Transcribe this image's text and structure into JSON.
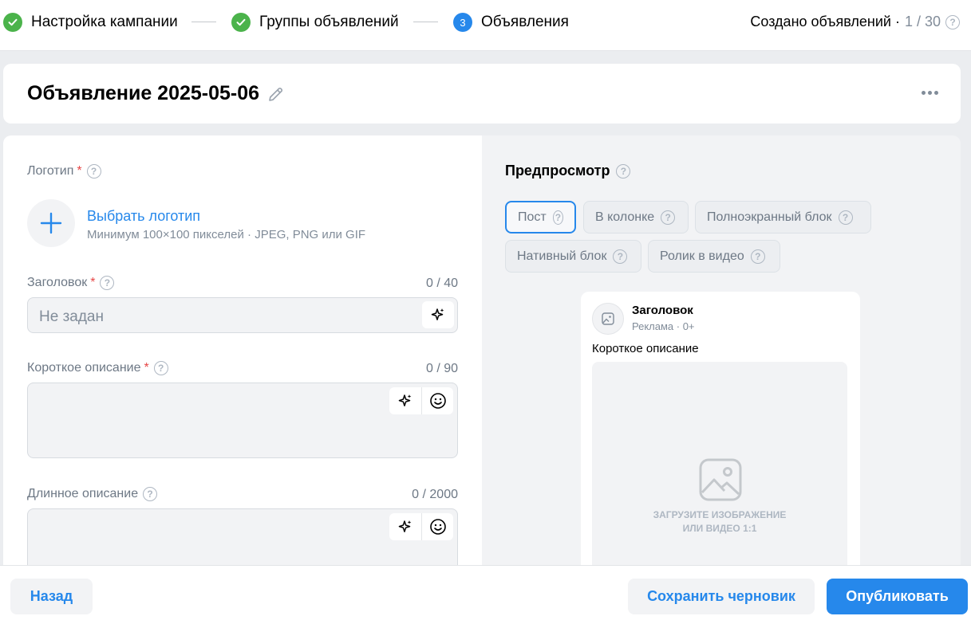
{
  "stepper": {
    "steps": [
      {
        "label": "Настройка кампании",
        "state": "done"
      },
      {
        "label": "Группы объявлений",
        "state": "done"
      },
      {
        "label": "Объявления",
        "state": "current",
        "number": "3"
      }
    ],
    "created_label": "Создано объявлений ·",
    "created_count": "1 / 30"
  },
  "ad": {
    "title": "Объявление 2025-05-06"
  },
  "form": {
    "logo": {
      "label": "Логотип",
      "required_mark": "*",
      "choose_link": "Выбрать логотип",
      "hint": "Минимум 100×100 пикселей · JPEG, PNG или GIF"
    },
    "headline": {
      "label": "Заголовок",
      "required_mark": "*",
      "counter": "0 / 40",
      "placeholder": "Не задан"
    },
    "short_desc": {
      "label": "Короткое описание",
      "required_mark": "*",
      "counter": "0 / 90"
    },
    "long_desc": {
      "label": "Длинное описание",
      "counter": "0 / 2000"
    }
  },
  "preview": {
    "title": "Предпросмотр",
    "formats": [
      "Пост",
      "В колонке",
      "Полноэкранный блок",
      "Нативный блок",
      "Ролик в видео"
    ],
    "active_format": "Пост",
    "post": {
      "headline": "Заголовок",
      "sub": "Реклама · 0+",
      "description": "Короткое описание",
      "media_line1": "ЗАГРУЗИТЕ ИЗОБРАЖЕНИЕ",
      "media_line2": "ИЛИ ВИДЕО 1:1"
    }
  },
  "footer": {
    "back": "Назад",
    "save_draft": "Сохранить черновик",
    "publish": "Опубликовать"
  },
  "colors": {
    "accent": "#2688eb",
    "success": "#4bb34b",
    "required": "#e64646"
  }
}
